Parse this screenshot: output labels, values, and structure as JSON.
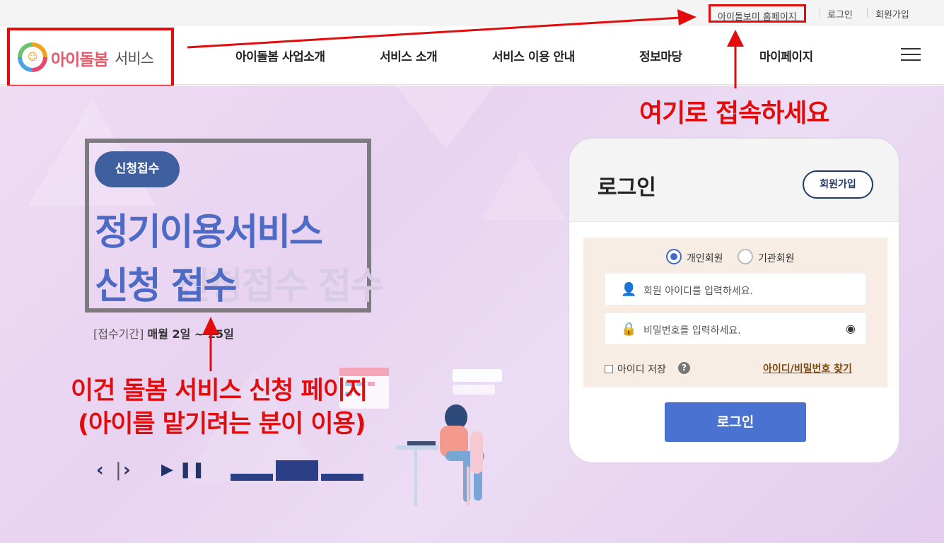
{
  "util": {
    "home": "아이돌보미 홈페이지",
    "login": "로그인",
    "join": "회원가입"
  },
  "logo": {
    "text_main": "아이돌봄",
    "text_sub": "서비스"
  },
  "nav": [
    "아이돌봄 사업소개",
    "서비스 소개",
    "서비스 이용 안내",
    "정보마당",
    "마이페이지"
  ],
  "hero": {
    "badge": "신청접수",
    "title1": "정기이용서비스",
    "title2": "신청 접수",
    "ghost": "신청접수 접수",
    "period_label": "[접수기간]",
    "period_value": "매월 2일 ~ 25일"
  },
  "annotations": {
    "top": "여기로 접속하세요",
    "bottom1": "이건 돌봄 서비스 신청 페이지",
    "bottom2": "(아이를 맡기려는 분이 이용)"
  },
  "login": {
    "title": "로그인",
    "join": "회원가입",
    "radio_personal": "개인회원",
    "radio_org": "기관회원",
    "id_placeholder": "회원 아이디를 입력하세요.",
    "pw_placeholder": "비밀번호를 입력하세요.",
    "save_id": "아이디 저장",
    "find": "아이디/비밀번호 찾기",
    "submit": "로그인"
  },
  "colors": {
    "accent": "#4a72d1",
    "annotation": "#e10d0d",
    "hero_text": "#4d6bc4"
  }
}
